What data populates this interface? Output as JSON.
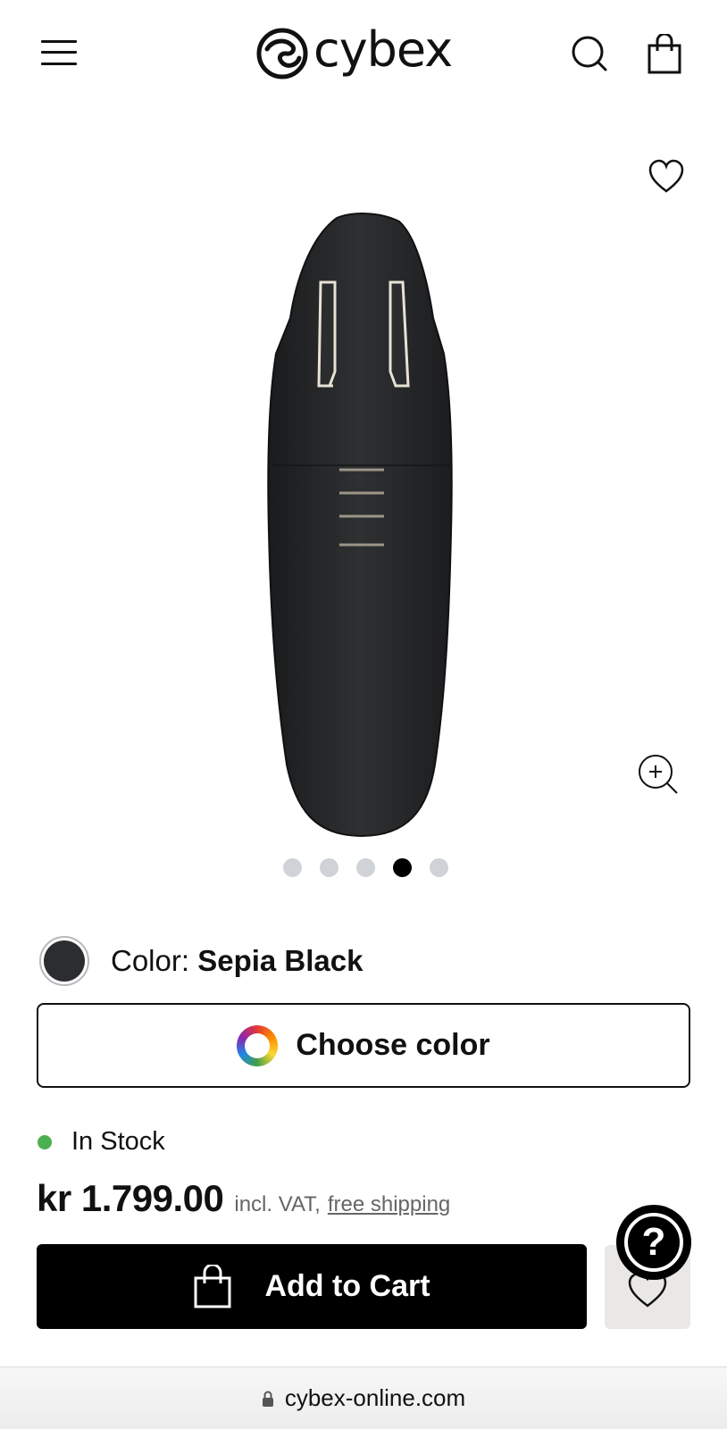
{
  "header": {
    "brand": "cybex",
    "icons": [
      "menu-icon",
      "search-icon",
      "shopping-bag-icon"
    ]
  },
  "gallery": {
    "image_alt": "Sepia Black footmuff",
    "slide_count": 5,
    "active_slide": 4,
    "icons": [
      "heart-icon",
      "zoom-in-icon"
    ]
  },
  "product": {
    "color_label": "Color:",
    "color_value": "Sepia Black",
    "color_hex": "#2b2d30",
    "choose_color": "Choose color",
    "stock_status": "In Stock",
    "stock_color": "#4caf50",
    "price": "kr 1.799.00",
    "vat_note": "incl. VAT,",
    "shipping": "free shipping",
    "add_to_cart": "Add to Cart"
  },
  "help": {
    "label": "?"
  },
  "browser": {
    "url": "cybex-online.com"
  }
}
